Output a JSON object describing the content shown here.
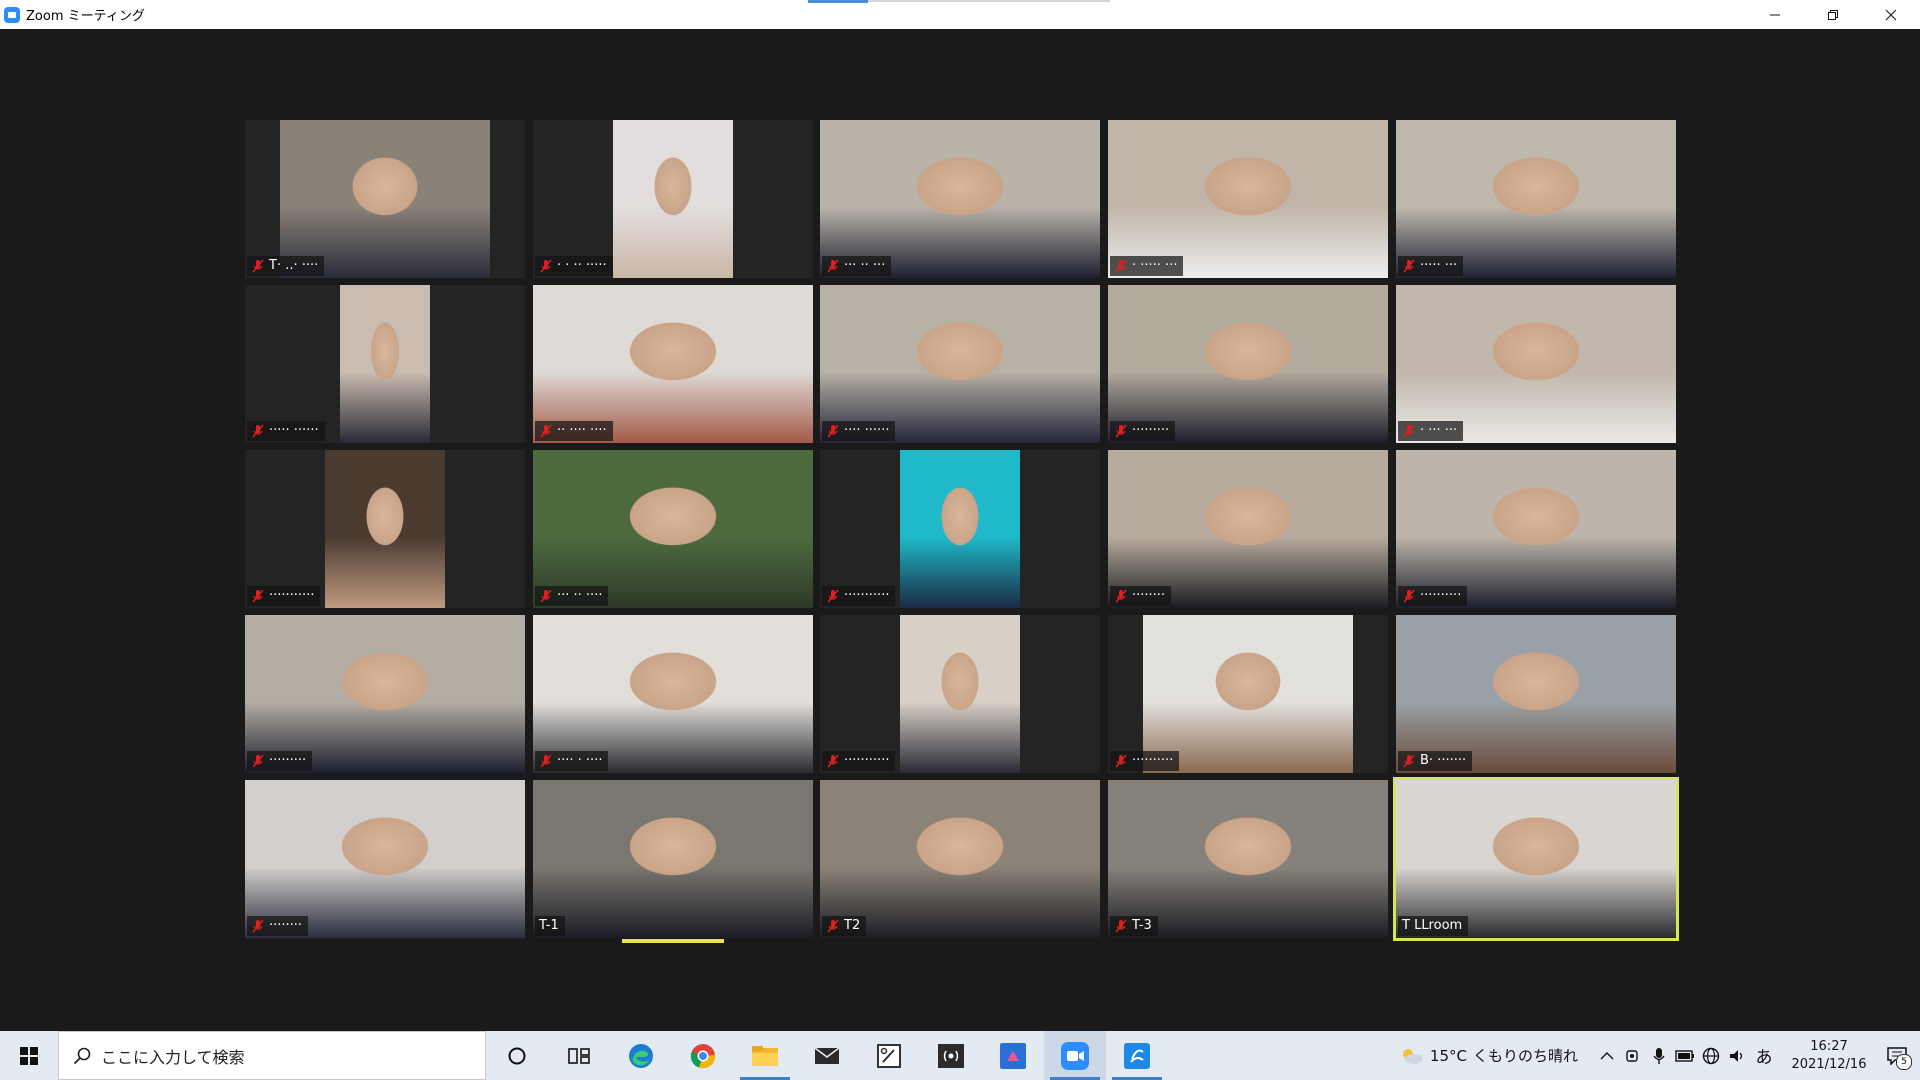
{
  "window": {
    "title": "Zoom ミーティング"
  },
  "gallery": {
    "tiles": [
      {
        "name": "T· ..· ····",
        "muted": true,
        "video_bg": "#8a8278",
        "video_accent": "#2a2c3a"
      },
      {
        "name": "· · ·· ·····",
        "muted": true,
        "video_bg": "#e3dedd",
        "video_accent": "#c9b6a6"
      },
      {
        "name": "··· ·· ···",
        "muted": true,
        "video_bg": "#bab3aa",
        "video_accent": "#1f2030"
      },
      {
        "name": "· ····· ···",
        "muted": true,
        "video_bg": "#c0b5a8",
        "video_accent": "#eeeeee"
      },
      {
        "name": "····· ···",
        "muted": true,
        "video_bg": "#bfb8ad",
        "video_accent": "#1f2234"
      },
      {
        "name": "····· ······",
        "muted": true,
        "video_bg": "#cabcb0",
        "video_accent": "#2a2a35"
      },
      {
        "name": "·· ···· ····",
        "muted": true,
        "video_bg": "#dedad5",
        "video_accent": "#a35a48"
      },
      {
        "name": "···· ······",
        "muted": true,
        "video_bg": "#b8b1a6",
        "video_accent": "#24253a"
      },
      {
        "name": "·········",
        "muted": true,
        "video_bg": "#b3aa9e",
        "video_accent": "#1d1e2c"
      },
      {
        "name": "· ··· ···",
        "muted": true,
        "video_bg": "#c1b7ac",
        "video_accent": "#ebe9e6"
      },
      {
        "name": "···········",
        "muted": true,
        "video_bg": "#4a3a30",
        "video_accent": "#c09a80"
      },
      {
        "name": "··· ·· ····",
        "muted": true,
        "video_bg": "#4d6a3e",
        "video_accent": "#2e3a28"
      },
      {
        "name": "···········",
        "muted": true,
        "video_bg": "#1fb9c9",
        "video_accent": "#1b2a45"
      },
      {
        "name": "········",
        "muted": true,
        "video_bg": "#b7ab9d",
        "video_accent": "#1c1c22"
      },
      {
        "name": "··········",
        "muted": true,
        "video_bg": "#bdb5ab",
        "video_accent": "#1e1f2c"
      },
      {
        "name": "·········",
        "muted": true,
        "video_bg": "#b4ada4",
        "video_accent": "#1d1f2e"
      },
      {
        "name": "···· · ····",
        "muted": true,
        "video_bg": "#e2dfdb",
        "video_accent": "#2a2a30"
      },
      {
        "name": "···········",
        "muted": true,
        "video_bg": "#d8cfc6",
        "video_accent": "#2a2b36"
      },
      {
        "name": "··········",
        "muted": true,
        "video_bg": "#e3e1dd",
        "video_accent": "#8a6a50"
      },
      {
        "name": "B· ·······",
        "muted": true,
        "video_bg": "#9aa1a6",
        "video_accent": "#6a4b3a"
      },
      {
        "name": "········",
        "muted": true,
        "video_bg": "#d2cfcc",
        "video_accent": "#2a2d3c"
      },
      {
        "name": "T-1",
        "muted": false,
        "video_bg": "#7a7670",
        "video_accent": "#1b1c24"
      },
      {
        "name": "T2",
        "muted": true,
        "video_bg": "#8c8378",
        "video_accent": "#1d1d24"
      },
      {
        "name": "T-3",
        "muted": true,
        "video_bg": "#86827b",
        "video_accent": "#1c1c22"
      },
      {
        "name": "T LLroom",
        "muted": false,
        "video_bg": "#d9d6d2",
        "video_accent": "#2a2a2e"
      }
    ]
  },
  "colors": {
    "active_speaker_outline": "#d6e65a",
    "mute_red": "#e02020"
  },
  "taskbar": {
    "search_placeholder": "ここに入力して検索",
    "apps": [
      "cortana-icon",
      "task-view-icon",
      "edge-icon",
      "chrome-icon",
      "file-explorer-icon",
      "mail-icon",
      "snipping-icon",
      "broadcast-icon",
      "app-blue-icon",
      "zoom-icon",
      "app-blue-2-icon"
    ],
    "weather_temp": "15°C",
    "weather_text": "くもりのち晴れ",
    "ime_label": "あ",
    "time": "16:27",
    "date": "2021/12/16",
    "notification_count": "5"
  }
}
